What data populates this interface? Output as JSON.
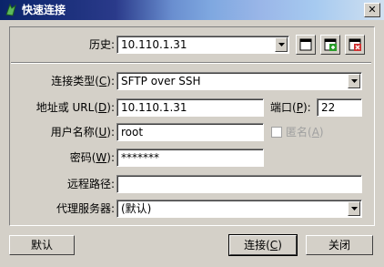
{
  "window": {
    "title": "快速连接"
  },
  "history": {
    "label": "历史:",
    "value": "10.110.1.31"
  },
  "conn_type": {
    "label_pre": "连接类型(",
    "key": "C",
    "label_post": "):",
    "value": "SFTP over SSH"
  },
  "address": {
    "label_pre": "地址或 URL(",
    "key": "D",
    "label_post": "):",
    "value": "10.110.1.31"
  },
  "port": {
    "label_pre": "端口(",
    "key": "P",
    "label_post": "):",
    "value": "22"
  },
  "username": {
    "label_pre": "用户名称(",
    "key": "U",
    "label_post": "):",
    "value": "root"
  },
  "anonymous": {
    "label_pre": "匿名(",
    "key": "A",
    "label_post": ")"
  },
  "password": {
    "label_pre": "密码(",
    "key": "W",
    "label_post": "):",
    "value": "*******"
  },
  "remote_path": {
    "label": "远程路径:",
    "value": ""
  },
  "proxy": {
    "label": "代理服务器:",
    "value": "(默认)"
  },
  "buttons": {
    "default": "默认",
    "connect_pre": "连接(",
    "connect_key": "C",
    "connect_post": ")",
    "close": "关闭"
  }
}
